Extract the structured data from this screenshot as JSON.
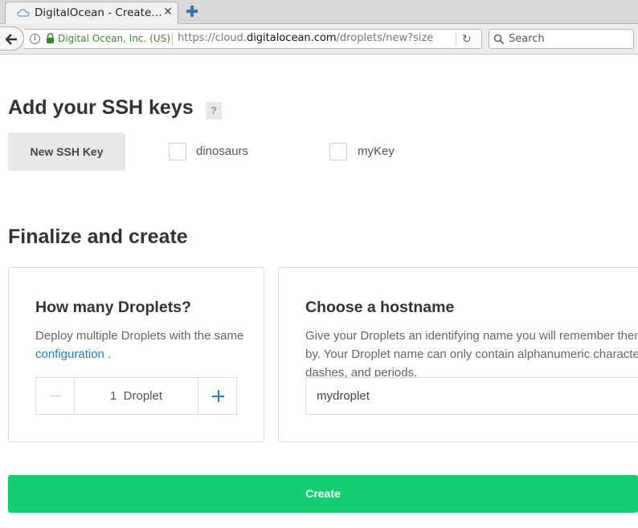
{
  "browser": {
    "tab_title": "DigitalOcean - Create…",
    "tab_close": "✕",
    "cert_owner": "Digital Ocean, Inc. (US)",
    "url_prefix": "https://cloud.",
    "url_host": "digitalocean.com",
    "url_path": "/droplets/new?size",
    "search_placeholder": "Search",
    "info_glyph": "i",
    "reload_glyph": "↻"
  },
  "ssh": {
    "heading": "Add your SSH keys",
    "help": "?",
    "new_key_label": "New SSH Key",
    "keys": [
      {
        "label": "dinosaurs",
        "checked": false
      },
      {
        "label": "myKey",
        "checked": false
      }
    ]
  },
  "finalize": {
    "heading": "Finalize and create",
    "droplets_card": {
      "title": "How many Droplets?",
      "desc_before": "Deploy multiple Droplets with the same",
      "desc_link": "configuration",
      "desc_after": ".",
      "count": "1",
      "unit": "Droplet"
    },
    "hostname_card": {
      "title": "Choose a hostname",
      "desc": "Give your Droplets an identifying name you will remember them by. Your Droplet name can only contain alphanumeric characters, dashes, and periods.",
      "hostname_value": "mydroplet"
    },
    "create_label": "Create"
  },
  "colors": {
    "create_button": "#15cd72",
    "link": "#1e7cc8",
    "secure_text": "#3a8a1f"
  }
}
